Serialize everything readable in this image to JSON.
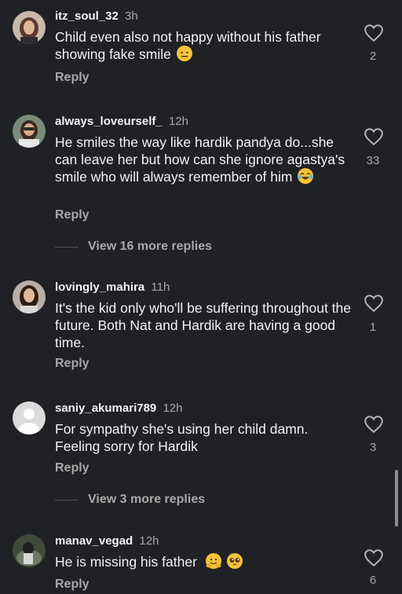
{
  "comments": [
    {
      "username": "itz_soul_32",
      "time": "3h",
      "text": "Child even also not happy without his father showing fake smile",
      "emoji": "expressionless",
      "reply": "Reply",
      "likes": "2"
    },
    {
      "username": "always_loveurself_",
      "time": "12h",
      "text": "He smiles the way like hardik pandya do...she can leave her but how can she ignore agastya's smile who will always remember of him",
      "emoji": "laughing-tears",
      "reply": "Reply",
      "likes": "33",
      "more_replies": "View 16 more replies"
    },
    {
      "username": "lovingly_mahira",
      "time": "11h",
      "text": "It's the kid only who'll be suffering throughout the future. Both Nat and Hardik are having a good time.",
      "reply": "Reply",
      "likes": "1"
    },
    {
      "username": "saniy_akumari789",
      "time": "12h",
      "text": "For sympathy she's using her child damn. Feeling sorry for Hardik",
      "reply": "Reply",
      "likes": "3",
      "more_replies": "View 3 more replies"
    },
    {
      "username": "manav_vegad",
      "time": "12h",
      "text": "He is missing his father",
      "emoji": "hugging, pleading",
      "reply": "Reply",
      "likes": "6"
    }
  ],
  "colors": {
    "background": "#1f2124",
    "text": "#f2f2f2",
    "muted": "#a8a8a8",
    "emoji": "#f6c33a"
  }
}
